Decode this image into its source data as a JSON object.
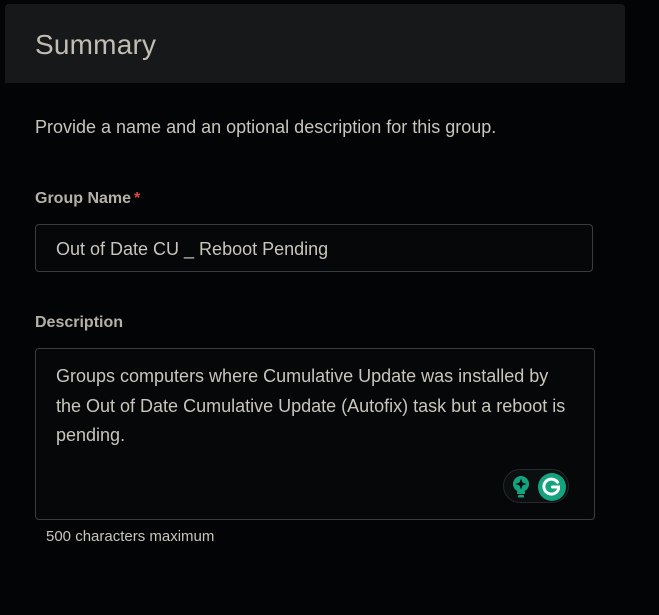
{
  "header": {
    "title": "Summary"
  },
  "intro": {
    "text": "Provide a name and an optional description for this group."
  },
  "group_name": {
    "label": "Group Name",
    "required_mark": "*",
    "value": "Out of Date CU _ Reboot Pending"
  },
  "description": {
    "label": "Description",
    "value": "Groups computers where Cumulative Update was installed by the Out of Date Cumulative Update (Autofix) task but a reboot is pending.",
    "helper": "500 characters maximum"
  },
  "colors": {
    "background": "#030405",
    "header_background": "#16181a",
    "required": "#e0483b",
    "assistant_accent": "#14a37f"
  },
  "icons": {
    "suggestion": "lightbulb-sparkle-icon",
    "assistant": "grammarly-g-icon"
  }
}
